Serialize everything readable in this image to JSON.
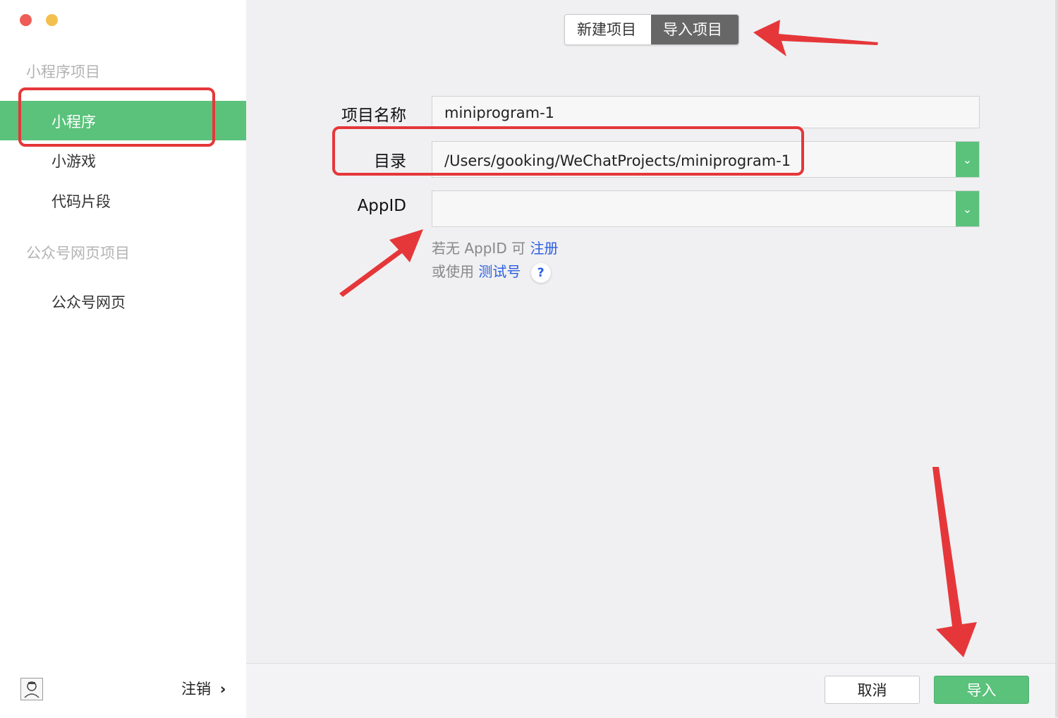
{
  "window": {
    "controls": [
      {
        "name": "close",
        "color": "#ee5e56"
      },
      {
        "name": "minimize",
        "color": "#f4bf4f"
      }
    ]
  },
  "sidebar": {
    "section_miniprogram": "小程序项目",
    "items": [
      {
        "label": "小程序",
        "active": true
      },
      {
        "label": "小游戏",
        "active": false
      },
      {
        "label": "代码片段",
        "active": false
      }
    ],
    "section_official": "公众号网页项目",
    "official_items": [
      {
        "label": "公众号网页",
        "active": false
      }
    ],
    "logout_label": "注销",
    "logout_chevron": "›"
  },
  "tabs": {
    "new_project": "新建项目",
    "import_project": "导入项目",
    "selected": "导入项目"
  },
  "form": {
    "project_name_label": "项目名称",
    "project_name_value": "miniprogram-1",
    "directory_label": "目录",
    "directory_value": "/Users/gooking/WeChatProjects/miniprogram-1",
    "appid_label": "AppID",
    "appid_value": "",
    "hint_line1_prefix": "若无 AppID 可",
    "hint_line1_link": "注册",
    "hint_line2_prefix": "或使用",
    "hint_line2_link": "测试号",
    "help_mark": "?"
  },
  "footer": {
    "cancel_label": "取消",
    "import_label": "导入"
  },
  "colors": {
    "accent_green": "#5ac27b",
    "link_blue": "#2b5fe0",
    "annotation_red": "#e5373a"
  }
}
